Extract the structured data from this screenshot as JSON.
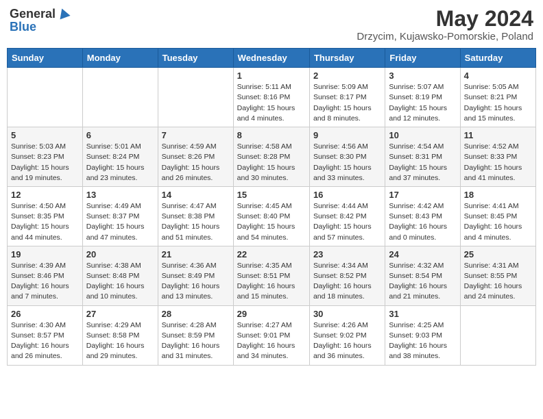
{
  "logo": {
    "general": "General",
    "blue": "Blue"
  },
  "title": "May 2024",
  "subtitle": "Drzycim, Kujawsko-Pomorskie, Poland",
  "days_of_week": [
    "Sunday",
    "Monday",
    "Tuesday",
    "Wednesday",
    "Thursday",
    "Friday",
    "Saturday"
  ],
  "weeks": [
    [
      {
        "day": "",
        "info": ""
      },
      {
        "day": "",
        "info": ""
      },
      {
        "day": "",
        "info": ""
      },
      {
        "day": "1",
        "info": "Sunrise: 5:11 AM\nSunset: 8:16 PM\nDaylight: 15 hours\nand 4 minutes."
      },
      {
        "day": "2",
        "info": "Sunrise: 5:09 AM\nSunset: 8:17 PM\nDaylight: 15 hours\nand 8 minutes."
      },
      {
        "day": "3",
        "info": "Sunrise: 5:07 AM\nSunset: 8:19 PM\nDaylight: 15 hours\nand 12 minutes."
      },
      {
        "day": "4",
        "info": "Sunrise: 5:05 AM\nSunset: 8:21 PM\nDaylight: 15 hours\nand 15 minutes."
      }
    ],
    [
      {
        "day": "5",
        "info": "Sunrise: 5:03 AM\nSunset: 8:23 PM\nDaylight: 15 hours\nand 19 minutes."
      },
      {
        "day": "6",
        "info": "Sunrise: 5:01 AM\nSunset: 8:24 PM\nDaylight: 15 hours\nand 23 minutes."
      },
      {
        "day": "7",
        "info": "Sunrise: 4:59 AM\nSunset: 8:26 PM\nDaylight: 15 hours\nand 26 minutes."
      },
      {
        "day": "8",
        "info": "Sunrise: 4:58 AM\nSunset: 8:28 PM\nDaylight: 15 hours\nand 30 minutes."
      },
      {
        "day": "9",
        "info": "Sunrise: 4:56 AM\nSunset: 8:30 PM\nDaylight: 15 hours\nand 33 minutes."
      },
      {
        "day": "10",
        "info": "Sunrise: 4:54 AM\nSunset: 8:31 PM\nDaylight: 15 hours\nand 37 minutes."
      },
      {
        "day": "11",
        "info": "Sunrise: 4:52 AM\nSunset: 8:33 PM\nDaylight: 15 hours\nand 41 minutes."
      }
    ],
    [
      {
        "day": "12",
        "info": "Sunrise: 4:50 AM\nSunset: 8:35 PM\nDaylight: 15 hours\nand 44 minutes."
      },
      {
        "day": "13",
        "info": "Sunrise: 4:49 AM\nSunset: 8:37 PM\nDaylight: 15 hours\nand 47 minutes."
      },
      {
        "day": "14",
        "info": "Sunrise: 4:47 AM\nSunset: 8:38 PM\nDaylight: 15 hours\nand 51 minutes."
      },
      {
        "day": "15",
        "info": "Sunrise: 4:45 AM\nSunset: 8:40 PM\nDaylight: 15 hours\nand 54 minutes."
      },
      {
        "day": "16",
        "info": "Sunrise: 4:44 AM\nSunset: 8:42 PM\nDaylight: 15 hours\nand 57 minutes."
      },
      {
        "day": "17",
        "info": "Sunrise: 4:42 AM\nSunset: 8:43 PM\nDaylight: 16 hours\nand 0 minutes."
      },
      {
        "day": "18",
        "info": "Sunrise: 4:41 AM\nSunset: 8:45 PM\nDaylight: 16 hours\nand 4 minutes."
      }
    ],
    [
      {
        "day": "19",
        "info": "Sunrise: 4:39 AM\nSunset: 8:46 PM\nDaylight: 16 hours\nand 7 minutes."
      },
      {
        "day": "20",
        "info": "Sunrise: 4:38 AM\nSunset: 8:48 PM\nDaylight: 16 hours\nand 10 minutes."
      },
      {
        "day": "21",
        "info": "Sunrise: 4:36 AM\nSunset: 8:49 PM\nDaylight: 16 hours\nand 13 minutes."
      },
      {
        "day": "22",
        "info": "Sunrise: 4:35 AM\nSunset: 8:51 PM\nDaylight: 16 hours\nand 15 minutes."
      },
      {
        "day": "23",
        "info": "Sunrise: 4:34 AM\nSunset: 8:52 PM\nDaylight: 16 hours\nand 18 minutes."
      },
      {
        "day": "24",
        "info": "Sunrise: 4:32 AM\nSunset: 8:54 PM\nDaylight: 16 hours\nand 21 minutes."
      },
      {
        "day": "25",
        "info": "Sunrise: 4:31 AM\nSunset: 8:55 PM\nDaylight: 16 hours\nand 24 minutes."
      }
    ],
    [
      {
        "day": "26",
        "info": "Sunrise: 4:30 AM\nSunset: 8:57 PM\nDaylight: 16 hours\nand 26 minutes."
      },
      {
        "day": "27",
        "info": "Sunrise: 4:29 AM\nSunset: 8:58 PM\nDaylight: 16 hours\nand 29 minutes."
      },
      {
        "day": "28",
        "info": "Sunrise: 4:28 AM\nSunset: 8:59 PM\nDaylight: 16 hours\nand 31 minutes."
      },
      {
        "day": "29",
        "info": "Sunrise: 4:27 AM\nSunset: 9:01 PM\nDaylight: 16 hours\nand 34 minutes."
      },
      {
        "day": "30",
        "info": "Sunrise: 4:26 AM\nSunset: 9:02 PM\nDaylight: 16 hours\nand 36 minutes."
      },
      {
        "day": "31",
        "info": "Sunrise: 4:25 AM\nSunset: 9:03 PM\nDaylight: 16 hours\nand 38 minutes."
      },
      {
        "day": "",
        "info": ""
      }
    ]
  ]
}
